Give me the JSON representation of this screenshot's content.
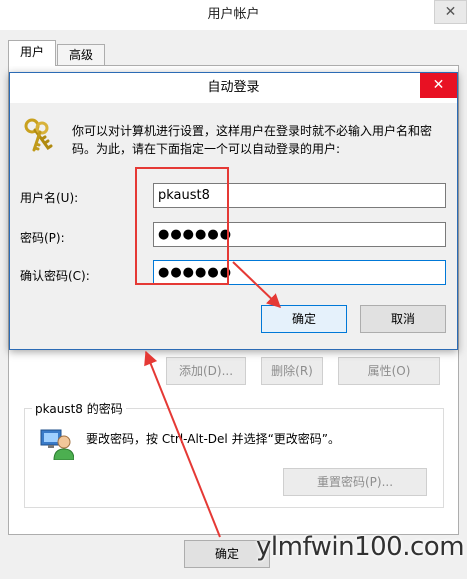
{
  "back_window": {
    "title": "用户帐户",
    "close_glyph": "✕",
    "tabs": [
      {
        "label": "用户"
      },
      {
        "label": "高级"
      }
    ],
    "buttons": {
      "add": "添加(D)...",
      "delete": "删除(R)",
      "properties": "属性(O)"
    },
    "password_group": {
      "title": "pkaust8 的密码",
      "text": "要改密码，按 Ctrl-Alt-Del 并选择“更改密码”。",
      "reset_button": "重置密码(P)..."
    },
    "ok_button": "确定"
  },
  "dialog": {
    "title": "自动登录",
    "close_glyph": "✕",
    "description_line1": "你可以对计算机进行设置，这样用户在登录时就不必输入用户名和密",
    "description_line2": "码。为此，请在下面指定一个可以自动登录的用户:",
    "fields": {
      "username_label": "用户名(U):",
      "username_value": "pkaust8",
      "password_label": "密码(P):",
      "password_value": "●●●●●●",
      "confirm_label": "确认密码(C):",
      "confirm_value": "●●●●●●"
    },
    "buttons": {
      "ok": "确定",
      "cancel": "取消"
    }
  },
  "watermark": "ylmfwin100.com",
  "colors": {
    "annotation": "#e53935",
    "close_red": "#e81123",
    "focus_blue": "#0078d7"
  }
}
